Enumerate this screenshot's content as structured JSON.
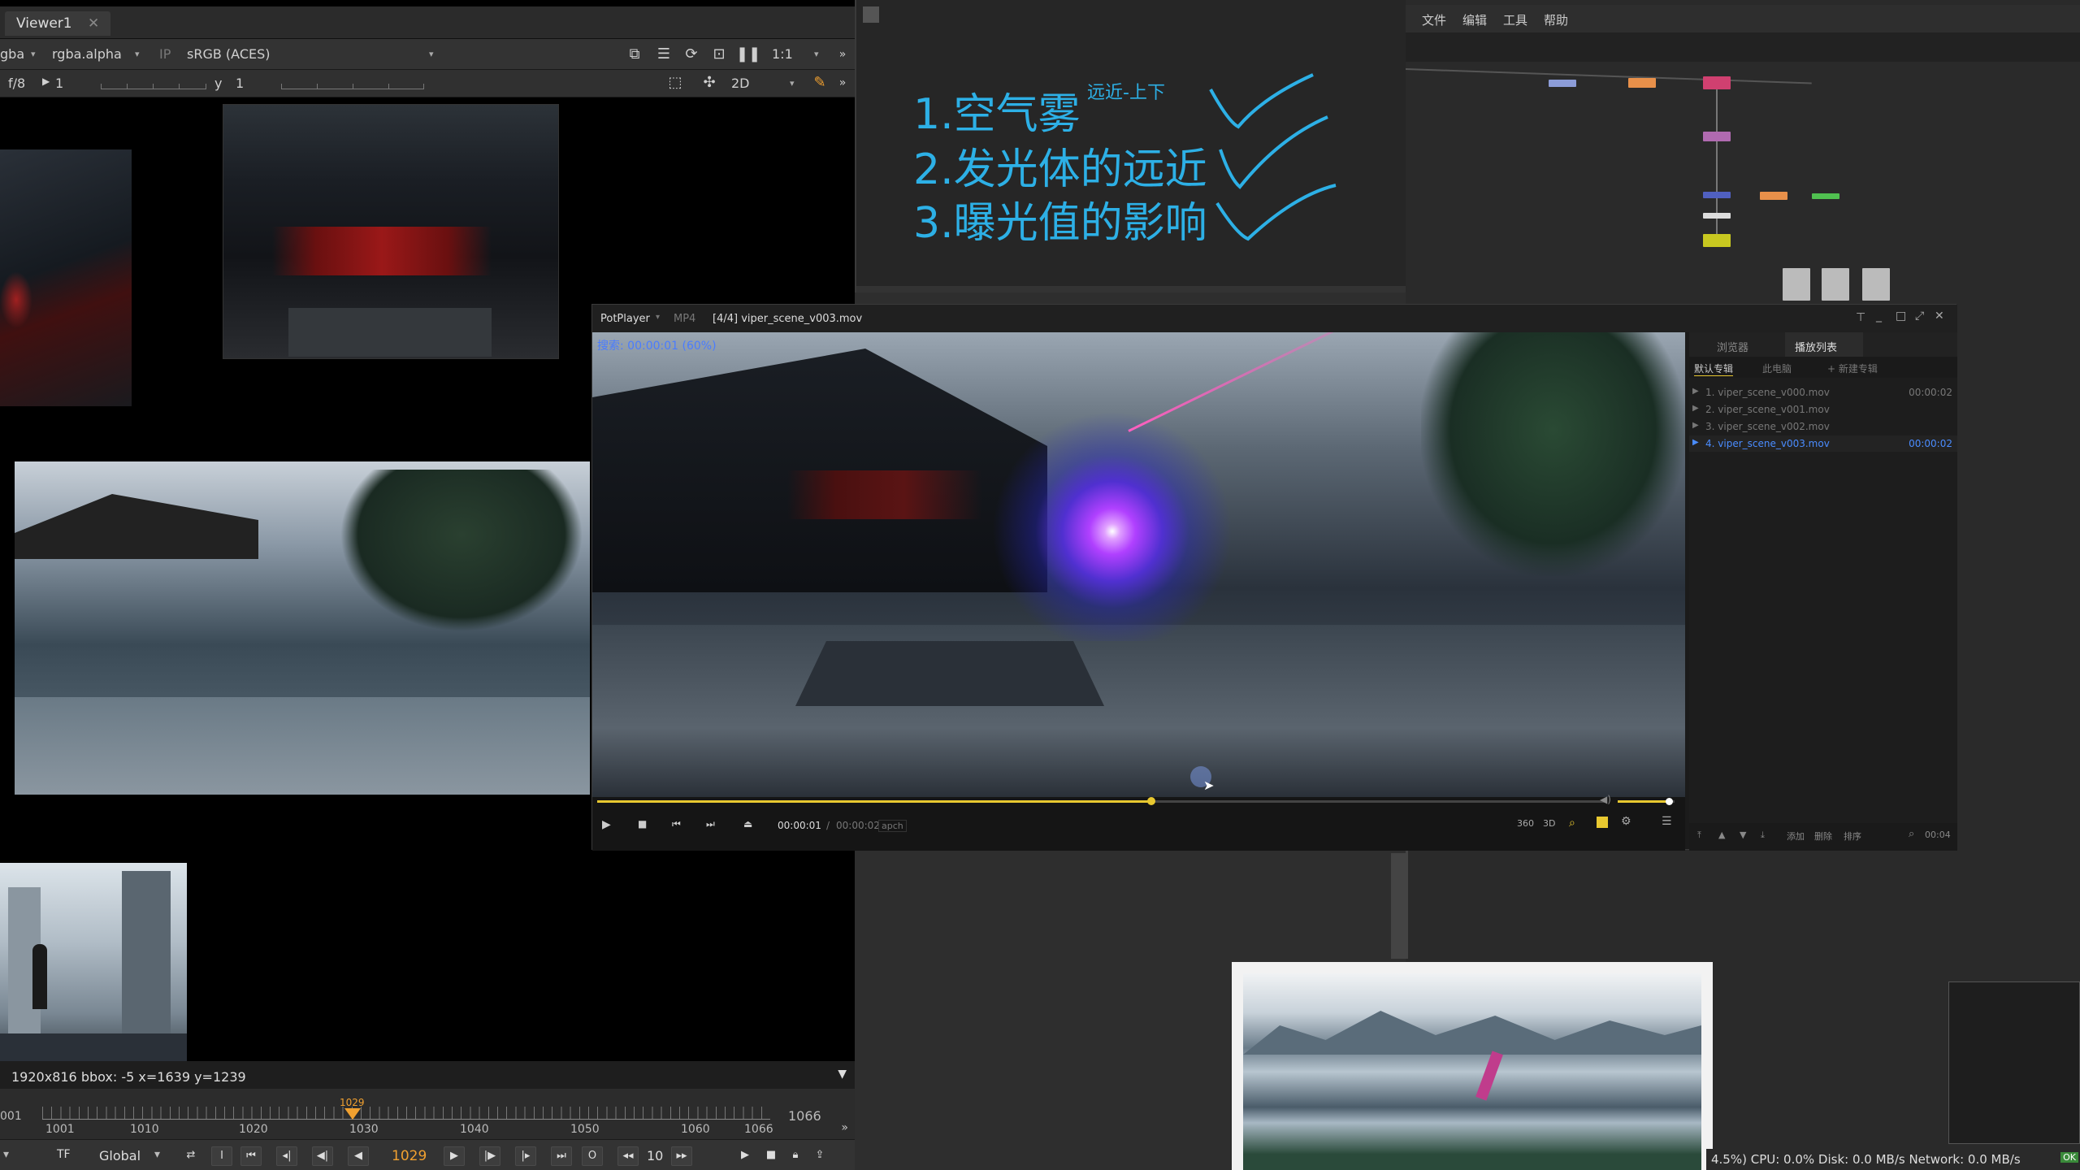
{
  "viewer": {
    "tab_label": "Viewer1",
    "channel_left": "gba",
    "channel_alpha": "rgba.alpha",
    "ip_label": "IP",
    "colorspace": "sRGB (ACES)",
    "zoom": "1:1",
    "fstop": "f/8",
    "gain_value": "1",
    "gamma_label": "y",
    "gamma_value": "1",
    "view_mode": "2D",
    "status_text": "1920x816  bbox: -5  x=1639 y=1239"
  },
  "timeline": {
    "start": "001",
    "end": "1066",
    "ticks": [
      "1001",
      "1010",
      "1020",
      "1030",
      "1040",
      "1050",
      "1060",
      "1066"
    ],
    "current_frame": "1029",
    "current_frame_marker": "1029",
    "scope": "Global",
    "tf": "TF",
    "step": "10"
  },
  "notes": {
    "line1": "1.空气雾",
    "line1_tag": "远近-上下",
    "line2": "2.发光体的远近",
    "line3": "3.曝光值的影响"
  },
  "menubar": [
    "文件",
    "编辑",
    "工具",
    "帮助"
  ],
  "potplayer": {
    "app_name": "PotPlayer",
    "format": "MP4",
    "title": "[4/4] viper_scene_v003.mov",
    "seek_text": "搜索: 00:00:01 (60%)",
    "time_current": "00:00:01",
    "time_total": "00:00:02",
    "codec": "apch",
    "progress": 0.55,
    "volume": 0.9,
    "btn_360": "360",
    "btn_3d": "3D",
    "tabs": [
      "浏览器",
      "播放列表"
    ],
    "subtabs": [
      "默认专辑",
      "此电脑",
      "+ 新建专辑"
    ],
    "playlist": [
      {
        "name": "1. viper_scene_v000.mov",
        "time": "00:00:02",
        "active": false
      },
      {
        "name": "2. viper_scene_v001.mov",
        "time": "",
        "active": false
      },
      {
        "name": "3. viper_scene_v002.mov",
        "time": "",
        "active": false
      },
      {
        "name": "4. viper_scene_v003.mov",
        "time": "00:00:02",
        "active": true
      }
    ],
    "list_buttons": [
      "添加",
      "删除",
      "排序"
    ],
    "list_count": "00:04"
  },
  "statusbar": "4.5%) CPU: 0.0% Disk: 0.0 MB/s Network: 0.0 MB/s",
  "statusbar_badge": "OK",
  "colors": {
    "accent_note": "#2db0e6",
    "frame_orange": "#f0a030",
    "progress_yellow": "#e8c830"
  }
}
